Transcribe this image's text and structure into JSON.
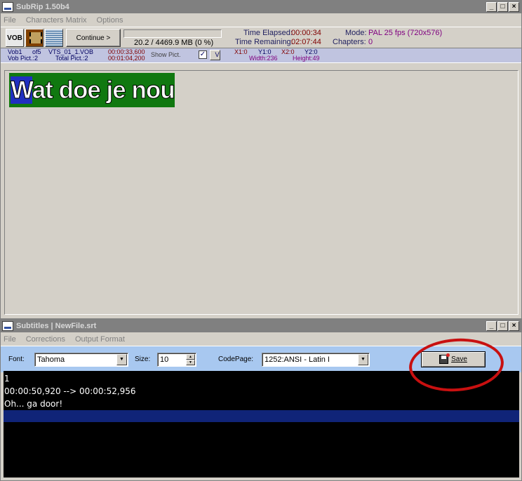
{
  "main": {
    "title": "SubRip 1.50b4",
    "menu": [
      "File",
      "Characters Matrix",
      "Options"
    ],
    "toolbar": {
      "vob_label": "VOB",
      "continue_label": "Continue  >",
      "progress_text": "20.2 / 4469.9 MB (0 %)",
      "time_elapsed_label": "Time Elapsed:",
      "time_elapsed": "00:00:34",
      "time_remaining_label": "Time Remaining:",
      "time_remaining": "02:07:44",
      "mode_label": "Mode:",
      "mode": "PAL 25 fps (720x576)",
      "chapters_label": "Chapters:",
      "chapters": "0"
    },
    "info": {
      "vob1": "Vob1",
      "of5": "of5",
      "vts": "VTS_01_1.VOB",
      "time1": "00:00:33,600",
      "vob_pict": "Vob Pict.:2",
      "total_pict": "Total Pict.:2",
      "time2": "00:01:04,200",
      "show_pict": "Show Pict.",
      "v_label": "V",
      "x1": "X1:0",
      "y1": "Y1:0",
      "x2": "X2:0",
      "y2": "Y2:0",
      "width": "Width:236",
      "height": "Height:49"
    },
    "subtitle_image": {
      "first_letter": "W",
      "rest": "at doe je nou...?"
    }
  },
  "subs": {
    "title": "Subtitles | NewFile.srt",
    "menu": [
      "File",
      "Corrections",
      "Output Format"
    ],
    "font_label": "Font:",
    "font_value": "Tahoma",
    "size_label": "Size:",
    "size_value": "10",
    "codepage_label": "CodePage:",
    "codepage_value": "1252:ANSI - Latin I",
    "save_label": "Save",
    "lines": [
      "1",
      "00:00:50,920 --> 00:00:52,956",
      "Oh... ga door!"
    ]
  },
  "colors": {
    "annotation_circle": "#c81010",
    "font_bar": "#a8c8f0",
    "selection": "#102478"
  }
}
